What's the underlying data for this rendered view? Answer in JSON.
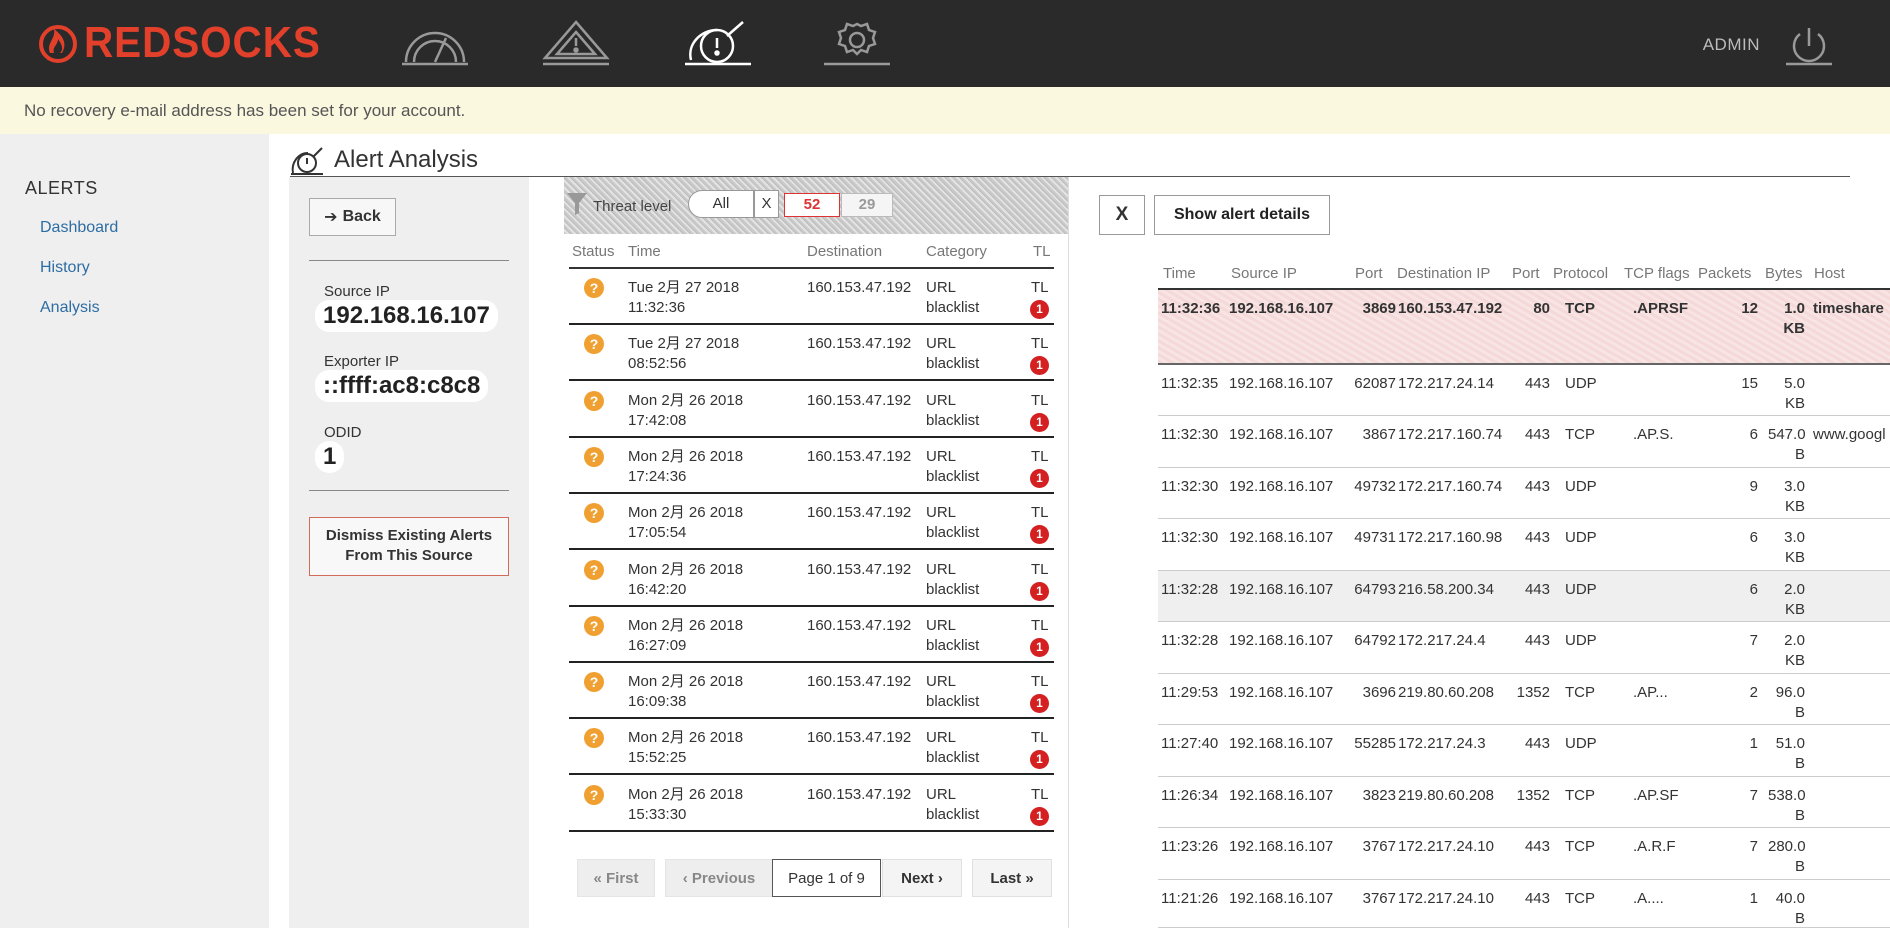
{
  "brand": {
    "name": "REDSOCKS",
    "accent": "#e2402b"
  },
  "header": {
    "nav_icons": [
      "dashboard-gauge-icon",
      "alert-triangle-icon",
      "analysis-radar-icon",
      "settings-gear-icon"
    ],
    "user_label": "ADMIN"
  },
  "notice": "No recovery e-mail address has been set for your account.",
  "sidebar": {
    "title": "ALERTS",
    "items": [
      {
        "label": "Dashboard"
      },
      {
        "label": "History"
      },
      {
        "label": "Analysis"
      }
    ]
  },
  "page": {
    "title": "Alert Analysis"
  },
  "info": {
    "back_label": "Back",
    "source_ip_label": "Source IP",
    "source_ip": "192.168.16.107",
    "exporter_ip_label": "Exporter IP",
    "exporter_ip": "::ffff:ac8:c8c8",
    "odid_label": "ODID",
    "odid": "1",
    "dismiss_line1": "Dismiss Existing Alerts",
    "dismiss_line2": "From This Source"
  },
  "filter": {
    "label": "Threat level",
    "all": "All",
    "clear": "X",
    "count_high": "52",
    "count_low": "29"
  },
  "alerts": {
    "columns": [
      "Status",
      "Time",
      "Destination",
      "Category",
      "TL"
    ],
    "rows": [
      {
        "status": "?",
        "date": "Tue 2月 27 2018",
        "time": "11:32:36",
        "destination": "160.153.47.192",
        "cat1": "URL",
        "cat2": "blacklist",
        "tl": "TL",
        "level": "1"
      },
      {
        "status": "?",
        "date": "Tue 2月 27 2018",
        "time": "08:52:56",
        "destination": "160.153.47.192",
        "cat1": "URL",
        "cat2": "blacklist",
        "tl": "TL",
        "level": "1"
      },
      {
        "status": "?",
        "date": "Mon 2月 26 2018",
        "time": "17:42:08",
        "destination": "160.153.47.192",
        "cat1": "URL",
        "cat2": "blacklist",
        "tl": "TL",
        "level": "1"
      },
      {
        "status": "?",
        "date": "Mon 2月 26 2018",
        "time": "17:24:36",
        "destination": "160.153.47.192",
        "cat1": "URL",
        "cat2": "blacklist",
        "tl": "TL",
        "level": "1"
      },
      {
        "status": "?",
        "date": "Mon 2月 26 2018",
        "time": "17:05:54",
        "destination": "160.153.47.192",
        "cat1": "URL",
        "cat2": "blacklist",
        "tl": "TL",
        "level": "1"
      },
      {
        "status": "?",
        "date": "Mon 2月 26 2018",
        "time": "16:42:20",
        "destination": "160.153.47.192",
        "cat1": "URL",
        "cat2": "blacklist",
        "tl": "TL",
        "level": "1"
      },
      {
        "status": "?",
        "date": "Mon 2月 26 2018",
        "time": "16:27:09",
        "destination": "160.153.47.192",
        "cat1": "URL",
        "cat2": "blacklist",
        "tl": "TL",
        "level": "1"
      },
      {
        "status": "?",
        "date": "Mon 2月 26 2018",
        "time": "16:09:38",
        "destination": "160.153.47.192",
        "cat1": "URL",
        "cat2": "blacklist",
        "tl": "TL",
        "level": "1"
      },
      {
        "status": "?",
        "date": "Mon 2月 26 2018",
        "time": "15:52:25",
        "destination": "160.153.47.192",
        "cat1": "URL",
        "cat2": "blacklist",
        "tl": "TL",
        "level": "1"
      },
      {
        "status": "?",
        "date": "Mon 2月 26 2018",
        "time": "15:33:30",
        "destination": "160.153.47.192",
        "cat1": "URL",
        "cat2": "blacklist",
        "tl": "TL",
        "level": "1"
      }
    ]
  },
  "pagination": {
    "first": "« First",
    "previous": "‹ Previous",
    "current": "Page 1 of 9",
    "next": "Next ›",
    "last": "Last »"
  },
  "details": {
    "close_label": "X",
    "show_label": "Show alert details"
  },
  "flows": {
    "columns": [
      "Time",
      "Source IP",
      "Port",
      "Destination IP",
      "Port",
      "Protocol",
      "TCP flags",
      "Packets",
      "Bytes",
      "Host"
    ],
    "rows": [
      {
        "time": "11:32:36",
        "src": "192.168.16.107",
        "sport": "3869",
        "dst": "160.153.47.192",
        "dport": "80",
        "proto": "TCP",
        "flags": ".APRSF",
        "packets": "12",
        "bytes1": "1.0",
        "bytes2": "KB",
        "host": "timeshare"
      },
      {
        "time": "11:32:35",
        "src": "192.168.16.107",
        "sport": "62087",
        "dst": "172.217.24.14",
        "dport": "443",
        "proto": "UDP",
        "flags": "",
        "packets": "15",
        "bytes1": "5.0",
        "bytes2": "KB",
        "host": ""
      },
      {
        "time": "11:32:30",
        "src": "192.168.16.107",
        "sport": "3867",
        "dst": "172.217.160.74",
        "dport": "443",
        "proto": "TCP",
        "flags": ".AP.S.",
        "packets": "6",
        "bytes1": "547.0",
        "bytes2": "B",
        "host": "www.googl"
      },
      {
        "time": "11:32:30",
        "src": "192.168.16.107",
        "sport": "49732",
        "dst": "172.217.160.74",
        "dport": "443",
        "proto": "UDP",
        "flags": "",
        "packets": "9",
        "bytes1": "3.0",
        "bytes2": "KB",
        "host": ""
      },
      {
        "time": "11:32:30",
        "src": "192.168.16.107",
        "sport": "49731",
        "dst": "172.217.160.98",
        "dport": "443",
        "proto": "UDP",
        "flags": "",
        "packets": "6",
        "bytes1": "3.0",
        "bytes2": "KB",
        "host": ""
      },
      {
        "time": "11:32:28",
        "src": "192.168.16.107",
        "sport": "64793",
        "dst": "216.58.200.34",
        "dport": "443",
        "proto": "UDP",
        "flags": "",
        "packets": "6",
        "bytes1": "2.0",
        "bytes2": "KB",
        "host": ""
      },
      {
        "time": "11:32:28",
        "src": "192.168.16.107",
        "sport": "64792",
        "dst": "172.217.24.4",
        "dport": "443",
        "proto": "UDP",
        "flags": "",
        "packets": "7",
        "bytes1": "2.0",
        "bytes2": "KB",
        "host": ""
      },
      {
        "time": "11:29:53",
        "src": "192.168.16.107",
        "sport": "3696",
        "dst": "219.80.60.208",
        "dport": "1352",
        "proto": "TCP",
        "flags": ".AP...",
        "packets": "2",
        "bytes1": "96.0",
        "bytes2": "B",
        "host": ""
      },
      {
        "time": "11:27:40",
        "src": "192.168.16.107",
        "sport": "55285",
        "dst": "172.217.24.3",
        "dport": "443",
        "proto": "UDP",
        "flags": "",
        "packets": "1",
        "bytes1": "51.0",
        "bytes2": "B",
        "host": ""
      },
      {
        "time": "11:26:34",
        "src": "192.168.16.107",
        "sport": "3823",
        "dst": "219.80.60.208",
        "dport": "1352",
        "proto": "TCP",
        "flags": ".AP.SF",
        "packets": "7",
        "bytes1": "538.0",
        "bytes2": "B",
        "host": ""
      },
      {
        "time": "11:23:26",
        "src": "192.168.16.107",
        "sport": "3767",
        "dst": "172.217.24.10",
        "dport": "443",
        "proto": "TCP",
        "flags": ".A.R.F",
        "packets": "7",
        "bytes1": "280.0",
        "bytes2": "B",
        "host": ""
      },
      {
        "time": "11:21:26",
        "src": "192.168.16.107",
        "sport": "3767",
        "dst": "172.217.24.10",
        "dport": "443",
        "proto": "TCP",
        "flags": ".A....",
        "packets": "1",
        "bytes1": "40.0",
        "bytes2": "B",
        "host": ""
      }
    ]
  }
}
